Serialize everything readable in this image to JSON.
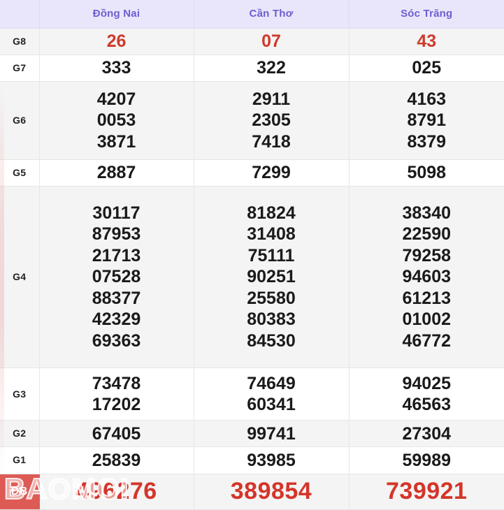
{
  "table": {
    "corner_label": "",
    "columns": [
      "Đồng Nai",
      "Cần Thơ",
      "Sóc Trăng"
    ],
    "accent_header_bg": "#e9e6fb",
    "accent_header_text": "#6c5ecf",
    "highlight_color": "#cf3a2a",
    "db_badge_bg": "#de5b55",
    "rows": [
      {
        "tier": "G8",
        "highlight": true,
        "values": [
          [
            "26"
          ],
          [
            "07"
          ],
          [
            "43"
          ]
        ]
      },
      {
        "tier": "G7",
        "highlight": false,
        "values": [
          [
            "333"
          ],
          [
            "322"
          ],
          [
            "025"
          ]
        ]
      },
      {
        "tier": "G6",
        "highlight": false,
        "values": [
          [
            "4207",
            "0053",
            "3871"
          ],
          [
            "2911",
            "2305",
            "7418"
          ],
          [
            "4163",
            "8791",
            "8379"
          ]
        ]
      },
      {
        "tier": "G5",
        "highlight": false,
        "values": [
          [
            "2887"
          ],
          [
            "7299"
          ],
          [
            "5098"
          ]
        ]
      },
      {
        "tier": "G4",
        "highlight": false,
        "values": [
          [
            "30117",
            "87953",
            "21713",
            "07528",
            "88377",
            "42329",
            "69363"
          ],
          [
            "81824",
            "31408",
            "75111",
            "90251",
            "25580",
            "80383",
            "84530"
          ],
          [
            "38340",
            "22590",
            "79258",
            "94603",
            "61213",
            "01002",
            "46772"
          ]
        ]
      },
      {
        "tier": "G3",
        "highlight": false,
        "values": [
          [
            "73478",
            "17202"
          ],
          [
            "74649",
            "60341"
          ],
          [
            "94025",
            "46563"
          ]
        ]
      },
      {
        "tier": "G2",
        "highlight": false,
        "values": [
          [
            "67405"
          ],
          [
            "99741"
          ],
          [
            "27304"
          ]
        ]
      },
      {
        "tier": "G1",
        "highlight": false,
        "values": [
          [
            "25839"
          ],
          [
            "93985"
          ],
          [
            "59989"
          ]
        ]
      },
      {
        "tier": "ĐB",
        "highlight": true,
        "values": [
          [
            "496276"
          ],
          [
            "389854"
          ],
          [
            "739921"
          ]
        ]
      }
    ]
  },
  "watermark": {
    "text": "BAOMOI"
  }
}
